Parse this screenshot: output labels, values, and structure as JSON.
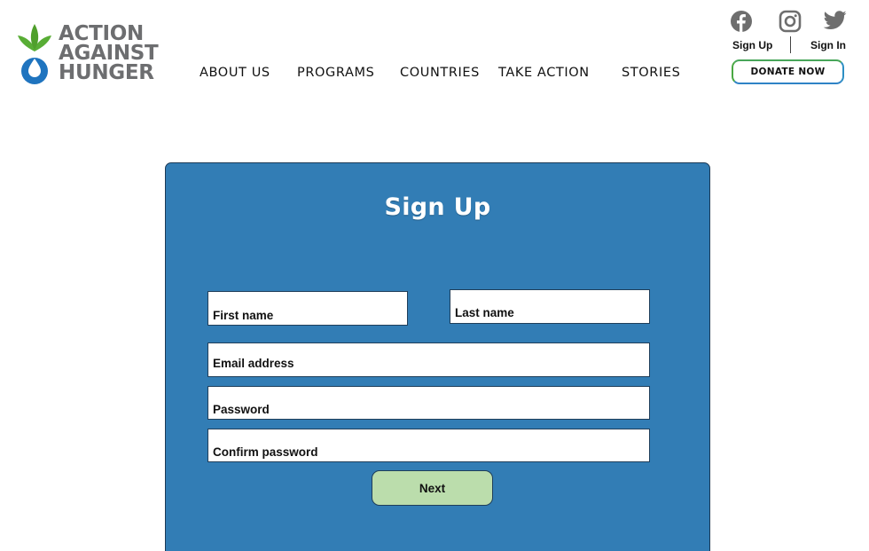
{
  "brand": {
    "logo_lines": [
      "ACTION",
      "AGAINST",
      "HUNGER"
    ],
    "green": "#58ad35",
    "blue": "#1f74bf",
    "gray": "#6d6e70"
  },
  "nav": {
    "items": [
      {
        "label": "ABOUT US",
        "name": "nav-about-us"
      },
      {
        "label": "PROGRAMS",
        "name": "nav-programs"
      },
      {
        "label": "COUNTRIES",
        "name": "nav-countries"
      },
      {
        "label": "TAKE ACTION",
        "name": "nav-take-action"
      },
      {
        "label": "STORIES",
        "name": "nav-stories"
      }
    ]
  },
  "header": {
    "social_icons": [
      "facebook-icon",
      "instagram-icon",
      "twitter-icon"
    ],
    "sign_up": "Sign Up",
    "sign_in": "Sign In",
    "donate": "DONATE NOW"
  },
  "form": {
    "title": "Sign Up",
    "panel_color": "#327db5",
    "first_name_placeholder": "First name",
    "last_name_placeholder": "Last name",
    "email_placeholder": "Email address",
    "password_placeholder": "Password",
    "confirm_password_placeholder": "Confirm password",
    "next_label": "Next",
    "next_color": "#bbddac"
  }
}
